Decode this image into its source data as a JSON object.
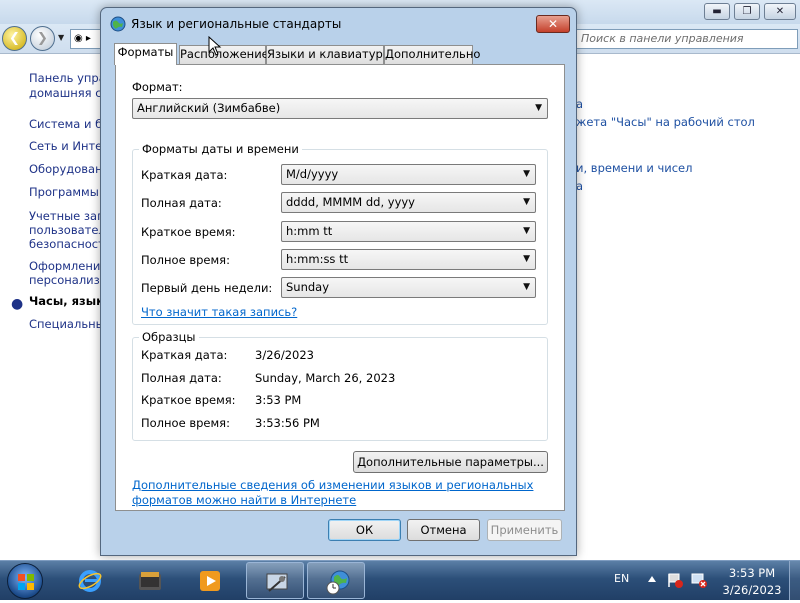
{
  "background_window": {
    "search_placeholder": "Поиск в панели управления",
    "address_text": "◉ ▸",
    "controls": {
      "minimize": "▬",
      "maximize": "❐",
      "close": "✕"
    },
    "sidebar": {
      "items": [
        {
          "label": "Панель управления"
        },
        {
          "label": "домашняя страница"
        },
        {
          "label": "Система и безопасность"
        },
        {
          "label": "Сеть и Интернет"
        },
        {
          "label": "Оборудование и звук"
        },
        {
          "label": "Программы"
        },
        {
          "label": "Учетные записи"
        },
        {
          "label": "пользователей и"
        },
        {
          "label": "безопасность"
        },
        {
          "label": "Оформление и"
        },
        {
          "label": "персонализация"
        },
        {
          "label": "Часы, язык"
        },
        {
          "label": "Специальные"
        }
      ]
    },
    "links": [
      {
        "text": "а"
      },
      {
        "text": "жета \"Часы\" на рабочий стол"
      },
      {
        "text": "и, времени и чисел"
      },
      {
        "text": "а"
      }
    ]
  },
  "dialog": {
    "title": "Язык и региональные стандарты",
    "close_glyph": "✕",
    "tabs": [
      {
        "label": "Форматы",
        "active": true
      },
      {
        "label": "Расположение",
        "active": false
      },
      {
        "label": "Языки и клавиатуры",
        "active": false
      },
      {
        "label": "Дополнительно",
        "active": false
      }
    ],
    "format_label": "Формат:",
    "format_value": "Английский (Зимбабве)",
    "datetime_group": {
      "title": "Форматы даты и времени",
      "rows": [
        {
          "label": "Краткая дата:",
          "value": "M/d/yyyy"
        },
        {
          "label": "Полная дата:",
          "value": "dddd, MMMM dd, yyyy"
        },
        {
          "label": "Краткое время:",
          "value": "h:mm tt"
        },
        {
          "label": "Полное время:",
          "value": "h:mm:ss tt"
        },
        {
          "label": "Первый день недели:",
          "value": "Sunday"
        }
      ],
      "help_link": "Что значит такая запись?"
    },
    "samples_group": {
      "title": "Образцы",
      "rows": [
        {
          "label": "Краткая дата:",
          "value": "3/26/2023"
        },
        {
          "label": "Полная дата:",
          "value": "Sunday, March 26, 2023"
        },
        {
          "label": "Краткое время:",
          "value": "3:53 PM"
        },
        {
          "label": "Полное время:",
          "value": "3:53:56 PM"
        }
      ]
    },
    "additional_settings_button": "Дополнительные параметры...",
    "info_link_line1": "Дополнительные сведения об изменении языков и региональных",
    "info_link_line2": "форматов можно найти в Интернете",
    "buttons": {
      "ok": "ОК",
      "cancel": "Отмена",
      "apply": "Применить"
    }
  },
  "taskbar": {
    "language": "EN",
    "time": "3:53 PM",
    "date": "3/26/2023",
    "apps": [
      {
        "name": "Internet Explorer",
        "open": false
      },
      {
        "name": "Explorer",
        "open": false
      },
      {
        "name": "Media Player",
        "open": false
      },
      {
        "name": "Control Panel",
        "open": true
      },
      {
        "name": "Region and Language",
        "open": true
      }
    ]
  }
}
